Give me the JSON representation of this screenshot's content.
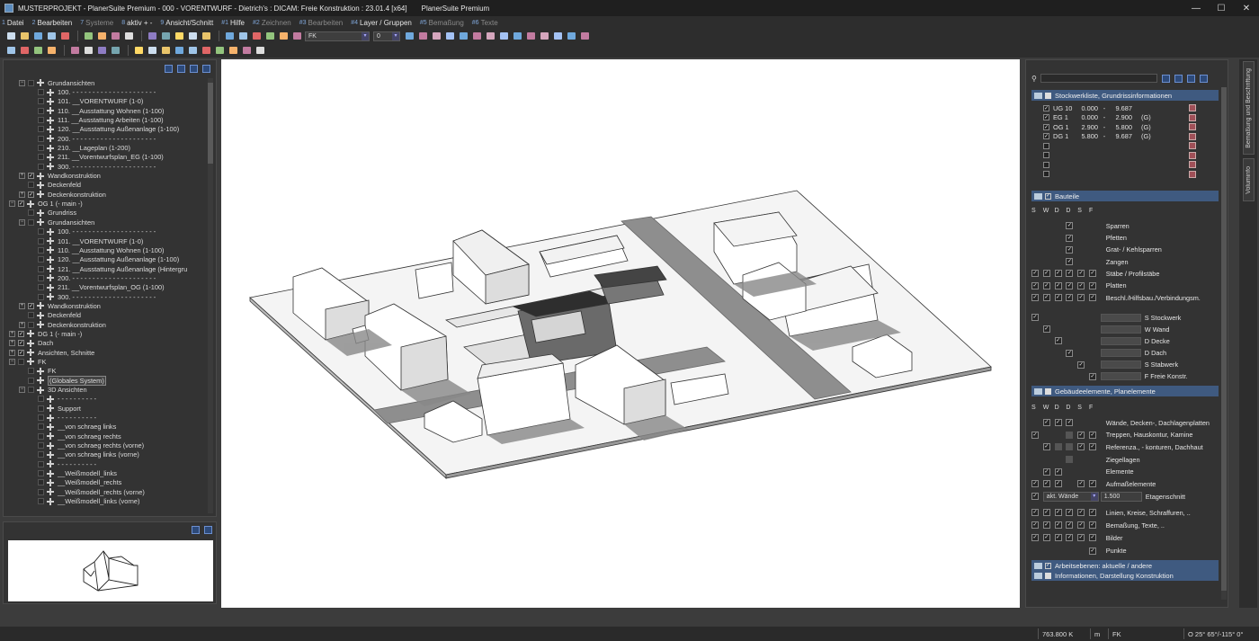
{
  "window": {
    "title": "MUSTERPROJEKT - PlanerSuite Premium - 000 - VORENTWURF - Dietrich's : DICAM: Freie Konstruktion : 23.01.4 [x64]",
    "title2": "PlanerSuite Premium",
    "min": "—",
    "max": "☐",
    "close": "✕"
  },
  "menu": [
    {
      "num": "1",
      "label": "Datei",
      "dim": false
    },
    {
      "num": "2",
      "label": "Bearbeiten",
      "dim": false
    },
    {
      "num": "7",
      "label": "Systeme",
      "dim": true
    },
    {
      "num": "8",
      "label": "aktiv + -",
      "dim": false
    },
    {
      "num": "9",
      "label": "Ansicht/Schnitt",
      "dim": false
    },
    {
      "num": "#1",
      "label": "Hilfe",
      "dim": false
    },
    {
      "num": "#2",
      "label": "Zeichnen",
      "dim": true
    },
    {
      "num": "#3",
      "label": "Bearbeiten",
      "dim": true
    },
    {
      "num": "#4",
      "label": "Layer / Gruppen",
      "dim": false
    },
    {
      "num": "#5",
      "label": "Bemaßung",
      "dim": true
    },
    {
      "num": "#6",
      "label": "Texte",
      "dim": true
    }
  ],
  "toolbar": {
    "layer_combo": "FK",
    "number_combo": "0"
  },
  "tree": [
    {
      "d": 1,
      "exp": "−",
      "cb": "",
      "dim": true,
      "label": "Grundansichten"
    },
    {
      "d": 2,
      "exp": "",
      "cb": "",
      "dim": true,
      "label": "100. - - - - - - - - - - - - - - - - - - - - -"
    },
    {
      "d": 2,
      "exp": "",
      "cb": "",
      "dim": true,
      "label": "101. __VORENTWURF (1-0)"
    },
    {
      "d": 2,
      "exp": "",
      "cb": "",
      "dim": true,
      "label": "110. __Ausstattung Wohnen (1-100)"
    },
    {
      "d": 2,
      "exp": "",
      "cb": "",
      "dim": true,
      "label": "111. __Ausstattung Arbeiten (1-100)"
    },
    {
      "d": 2,
      "exp": "",
      "cb": "",
      "dim": true,
      "label": "120. __Ausstattung Außenanlage (1-100)"
    },
    {
      "d": 2,
      "exp": "",
      "cb": "",
      "dim": true,
      "label": "200. - - - - - - - - - - - - - - - - - - - - -"
    },
    {
      "d": 2,
      "exp": "",
      "cb": "",
      "dim": true,
      "label": "210. __Lageplan (1-200)"
    },
    {
      "d": 2,
      "exp": "",
      "cb": "",
      "dim": true,
      "label": "211. __Vorentwurfsplan_EG (1-100)"
    },
    {
      "d": 2,
      "exp": "",
      "cb": "",
      "dim": true,
      "label": "300. - - - - - - - - - - - - - - - - - - - - -"
    },
    {
      "d": 1,
      "exp": "+",
      "cb": "✓",
      "dim": false,
      "label": "Wandkonstruktion"
    },
    {
      "d": 1,
      "exp": "",
      "cb": "",
      "dim": true,
      "label": "Deckenfeld"
    },
    {
      "d": 1,
      "exp": "+",
      "cb": "✓",
      "dim": false,
      "label": "Deckenkonstruktion"
    },
    {
      "d": 0,
      "exp": "−",
      "cb": "✓",
      "dim": false,
      "label": "OG 1 (- main -)"
    },
    {
      "d": 1,
      "exp": "",
      "cb": "",
      "dim": true,
      "label": "Grundriss"
    },
    {
      "d": 1,
      "exp": "−",
      "cb": "",
      "dim": true,
      "label": "Grundansichten"
    },
    {
      "d": 2,
      "exp": "",
      "cb": "",
      "dim": true,
      "label": "100. - - - - - - - - - - - - - - - - - - - - -"
    },
    {
      "d": 2,
      "exp": "",
      "cb": "",
      "dim": true,
      "label": "101. __VORENTWURF (1-0)"
    },
    {
      "d": 2,
      "exp": "",
      "cb": "",
      "dim": true,
      "label": "110. __Ausstattung Wohnen (1-100)"
    },
    {
      "d": 2,
      "exp": "",
      "cb": "",
      "dim": true,
      "label": "120. __Ausstattung Außenanlage (1-100)"
    },
    {
      "d": 2,
      "exp": "",
      "cb": "",
      "dim": true,
      "label": "121. __Ausstattung Außenanlage (Hintergru"
    },
    {
      "d": 2,
      "exp": "",
      "cb": "",
      "dim": true,
      "label": "200. - - - - - - - - - - - - - - - - - - - - -"
    },
    {
      "d": 2,
      "exp": "",
      "cb": "",
      "dim": true,
      "label": "211. __Vorentwurfsplan_OG (1-100)"
    },
    {
      "d": 2,
      "exp": "",
      "cb": "",
      "dim": true,
      "label": "300. - - - - - - - - - - - - - - - - - - - - -"
    },
    {
      "d": 1,
      "exp": "+",
      "cb": "✓",
      "dim": false,
      "label": "Wandkonstruktion"
    },
    {
      "d": 1,
      "exp": "",
      "cb": "",
      "dim": true,
      "label": "Deckenfeld"
    },
    {
      "d": 1,
      "exp": "+",
      "cb": "",
      "dim": true,
      "label": "Deckenkonstruktion"
    },
    {
      "d": 0,
      "exp": "+",
      "cb": "✓",
      "dim": false,
      "label": "DG 1 (- main -)"
    },
    {
      "d": 0,
      "exp": "+",
      "cb": "✓",
      "dim": false,
      "label": "Dach"
    },
    {
      "d": 0,
      "exp": "+",
      "cb": "✓",
      "dim": false,
      "label": "Ansichten, Schnitte"
    },
    {
      "d": 0,
      "exp": "−",
      "cb": "",
      "dim": true,
      "label": "FK"
    },
    {
      "d": 1,
      "exp": "",
      "cb": "",
      "dim": true,
      "label": "FK"
    },
    {
      "d": 1,
      "exp": "",
      "cb": "",
      "dim": true,
      "label": "(Globales System)",
      "sel": true
    },
    {
      "d": 1,
      "exp": "−",
      "cb": "",
      "dim": true,
      "label": "3D Ansichten"
    },
    {
      "d": 2,
      "exp": "",
      "cb": "",
      "dim": true,
      "label": "- - - - - - - - - -"
    },
    {
      "d": 2,
      "exp": "",
      "cb": "",
      "dim": true,
      "label": "Support"
    },
    {
      "d": 2,
      "exp": "",
      "cb": "",
      "dim": true,
      "label": "- - - - - - - - - -"
    },
    {
      "d": 2,
      "exp": "",
      "cb": "",
      "dim": true,
      "label": "__von schraeg links"
    },
    {
      "d": 2,
      "exp": "",
      "cb": "",
      "dim": true,
      "label": "__von schraeg rechts"
    },
    {
      "d": 2,
      "exp": "",
      "cb": "",
      "dim": true,
      "label": "__von schraeg rechts (vorne)"
    },
    {
      "d": 2,
      "exp": "",
      "cb": "",
      "dim": true,
      "label": "__von schraeg links (vorne)"
    },
    {
      "d": 2,
      "exp": "",
      "cb": "",
      "dim": true,
      "label": "- - - - - - - - - -"
    },
    {
      "d": 2,
      "exp": "",
      "cb": "",
      "dim": true,
      "label": "__Weißmodell_links"
    },
    {
      "d": 2,
      "exp": "",
      "cb": "",
      "dim": true,
      "label": "__Weißmodell_rechts"
    },
    {
      "d": 2,
      "exp": "",
      "cb": "",
      "dim": true,
      "label": "__Weißmodell_rechts (vorne)"
    },
    {
      "d": 2,
      "exp": "",
      "cb": "",
      "dim": true,
      "label": "__Weißmodell_links (vorne)"
    }
  ],
  "right": {
    "sec_stockwerk": "Stockwerkliste, Grundrissinformationen",
    "stockwerke": [
      {
        "name": "UG 10",
        "from": "0.000",
        "to": "9.687",
        "g": ""
      },
      {
        "name": "EG 1",
        "from": "0.000",
        "to": "2.900",
        "g": "(G)"
      },
      {
        "name": "OG 1",
        "from": "2.900",
        "to": "5.800",
        "g": "(G)"
      },
      {
        "name": "DG 1",
        "from": "5.800",
        "to": "9.687",
        "g": "(G)"
      }
    ],
    "sec_bauteile": "Bauteile",
    "cols": [
      "S",
      "W",
      "D",
      "D",
      "S",
      "F"
    ],
    "bauteile": [
      {
        "c": [
          0,
          0,
          0,
          1,
          0,
          0
        ],
        "label": "Sparren"
      },
      {
        "c": [
          0,
          0,
          0,
          1,
          0,
          0
        ],
        "label": "Pfetten"
      },
      {
        "c": [
          0,
          0,
          0,
          1,
          0,
          0
        ],
        "label": "Grat- / Kehlsparren"
      },
      {
        "c": [
          0,
          0,
          0,
          1,
          0,
          0
        ],
        "label": "Zangen"
      },
      {
        "c": [
          1,
          1,
          1,
          1,
          1,
          1
        ],
        "label": "Stäbe / Profilstäbe"
      },
      {
        "c": [
          1,
          1,
          1,
          1,
          1,
          1
        ],
        "label": "Platten"
      },
      {
        "c": [
          1,
          1,
          1,
          1,
          1,
          1
        ],
        "label": "Beschl./Hilfsbau./Verbindungsm."
      }
    ],
    "stockwerk_sel": [
      {
        "c": [
          1,
          0,
          0,
          0,
          0,
          0
        ],
        "label": "S Stockwerk"
      },
      {
        "c": [
          0,
          1,
          0,
          0,
          0,
          0
        ],
        "label": "W Wand"
      },
      {
        "c": [
          0,
          0,
          1,
          0,
          0,
          0
        ],
        "label": "D Decke"
      },
      {
        "c": [
          0,
          0,
          0,
          1,
          0,
          0
        ],
        "label": "D Dach"
      },
      {
        "c": [
          0,
          0,
          0,
          0,
          1,
          0
        ],
        "label": "S Stabwerk"
      },
      {
        "c": [
          0,
          0,
          0,
          0,
          0,
          1
        ],
        "label": "F Freie Konstr."
      }
    ],
    "sec_gebaeude": "Gebäudeelemente, Planelemente",
    "cols2": [
      "S",
      "W",
      "D",
      "D",
      "S",
      "F"
    ],
    "gebaeude": [
      {
        "c": [
          0,
          1,
          1,
          1,
          0,
          0
        ],
        "label": "Wände, Decken-, Dachlagenplatten"
      },
      {
        "c": [
          1,
          0,
          0,
          2,
          1,
          1
        ],
        "label": "Treppen, Hauskontur, Kamine"
      },
      {
        "c": [
          0,
          1,
          2,
          2,
          1,
          1
        ],
        "label": "Referenza., - konturen, Dachhaut"
      },
      {
        "c": [
          0,
          0,
          0,
          2,
          0,
          0
        ],
        "label": "Ziegellagen"
      },
      {
        "c": [
          0,
          1,
          1,
          0,
          0,
          0
        ],
        "label": "Elemente"
      },
      {
        "c": [
          1,
          1,
          1,
          0,
          1,
          1
        ],
        "label": "Aufmaßelemente"
      }
    ],
    "etagen_combo": "akt. Wände",
    "etagen_value": "1.500",
    "etagen_label": "Etagenschnitt",
    "planelemente": [
      {
        "c": [
          1,
          1,
          1,
          1,
          1,
          1
        ],
        "label": "Linien, Kreise, Schraffuren, .."
      },
      {
        "c": [
          1,
          1,
          1,
          1,
          1,
          1
        ],
        "label": "Bemaßung, Texte, .."
      },
      {
        "c": [
          1,
          1,
          1,
          1,
          1,
          1
        ],
        "label": "Bilder"
      },
      {
        "c": [
          0,
          0,
          0,
          0,
          0,
          1
        ],
        "label": "Punkte"
      }
    ],
    "sec_arbeits": "Arbeitsebenen: aktuelle / andere",
    "sec_info": "Informationen, Darstellung Konstruktion"
  },
  "sidetabs": {
    "tab1": "Bemaßung und Beschriftung",
    "tab2": "Voluminfo"
  },
  "status": {
    "scale": "763.800 K",
    "unit": "m",
    "layer": "FK",
    "angles": "O 25° 65°/-115° 0°"
  },
  "colors": {
    "accent": "#3f5a80",
    "background": "#3c3c3c",
    "viewport": "#ffffff"
  }
}
